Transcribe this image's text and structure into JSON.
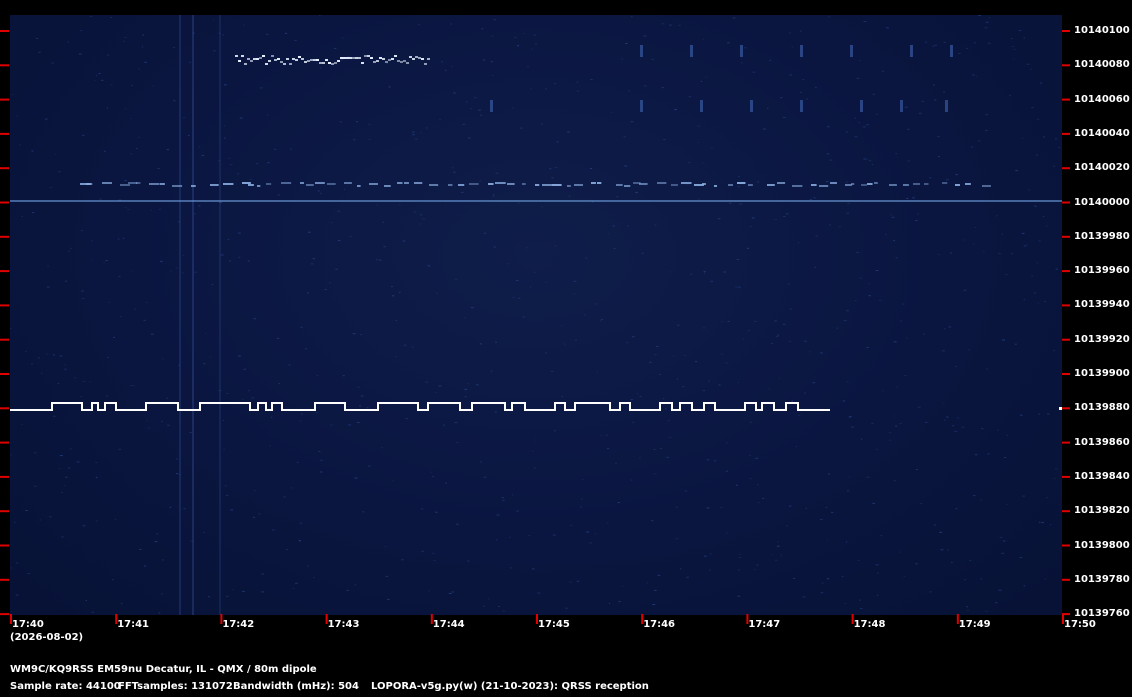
{
  "spectrogram": {
    "freq_labels": [
      "10140100",
      "10140080",
      "10140060",
      "10140040",
      "10140020",
      "10140000",
      "10139980",
      "10139960",
      "10139940",
      "10139920",
      "10139900",
      "10139880",
      "10139860",
      "10139840",
      "10139820",
      "10139800",
      "10139780",
      "10139760"
    ],
    "time_labels": [
      "17:40",
      "17:41",
      "17:42",
      "17:43",
      "17:44",
      "17:45",
      "17:46",
      "17:47",
      "17:48",
      "17:49",
      "17:50"
    ],
    "date": "(2026-08-02)",
    "colors": {
      "background": "#0a1640",
      "signal": "#ffffff",
      "tick": "#e00000"
    }
  },
  "footer": {
    "station": "WM9C/KQ9RSS EM59nu Decatur, IL - QMX / 80m dipole",
    "sample_rate": "Sample rate: 44100",
    "fft_samples": "FFTsamples: 131072",
    "bandwidth": "Bandwidth (mHz): 504",
    "software": "LOPORA-v5g.py(w) (21-10-2023): QRSS reception"
  }
}
